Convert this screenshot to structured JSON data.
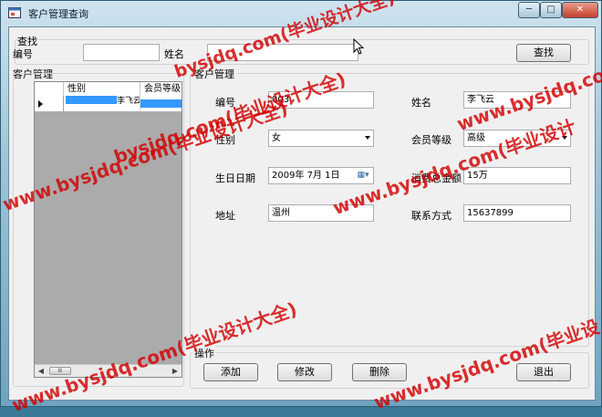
{
  "window": {
    "title": "客户管理查询",
    "controls": {
      "minimize": "─",
      "maximize": "□",
      "close": "✕"
    }
  },
  "search": {
    "group_label": "查找",
    "id_label": "编号",
    "id_value": "",
    "name_label": "姓名",
    "name_value": "",
    "button": "查找"
  },
  "grid": {
    "group_label": "客户管理",
    "columns": [
      "性别",
      "会员等级"
    ],
    "rows": [
      {
        "gender": "",
        "level": "",
        "name_fragment": "李飞云"
      }
    ],
    "scroll_thumb": "Ⅲ"
  },
  "detail": {
    "group_label": "客户管理",
    "fields": {
      "id": {
        "label": "编号",
        "value": "003"
      },
      "name": {
        "label": "姓名",
        "value": "李飞云"
      },
      "gender": {
        "label": "性别",
        "value": "女"
      },
      "level": {
        "label": "会员等级",
        "value": "高级"
      },
      "birthday": {
        "label": "生日日期",
        "value": "2009年  7月  1日"
      },
      "total": {
        "label": "消费总金额",
        "value": "15万"
      },
      "address": {
        "label": "地址",
        "value": "温州"
      },
      "contact": {
        "label": "联系方式",
        "value": "15637899"
      }
    }
  },
  "operations": {
    "group_label": "操作",
    "add": "添加",
    "edit": "修改",
    "delete": "删除",
    "exit": "退出"
  },
  "watermark": {
    "text_full": "www.bysjdq.com(毕业设计大全)",
    "text_a": "www.bysjdq.com(毕业设计",
    "text_b": "www.bysjdq.com(毕业设",
    "text_c": "bysjdq.com(毕业设计大全)",
    "text_d": "bysjdq.com(毕业设计大全)"
  }
}
